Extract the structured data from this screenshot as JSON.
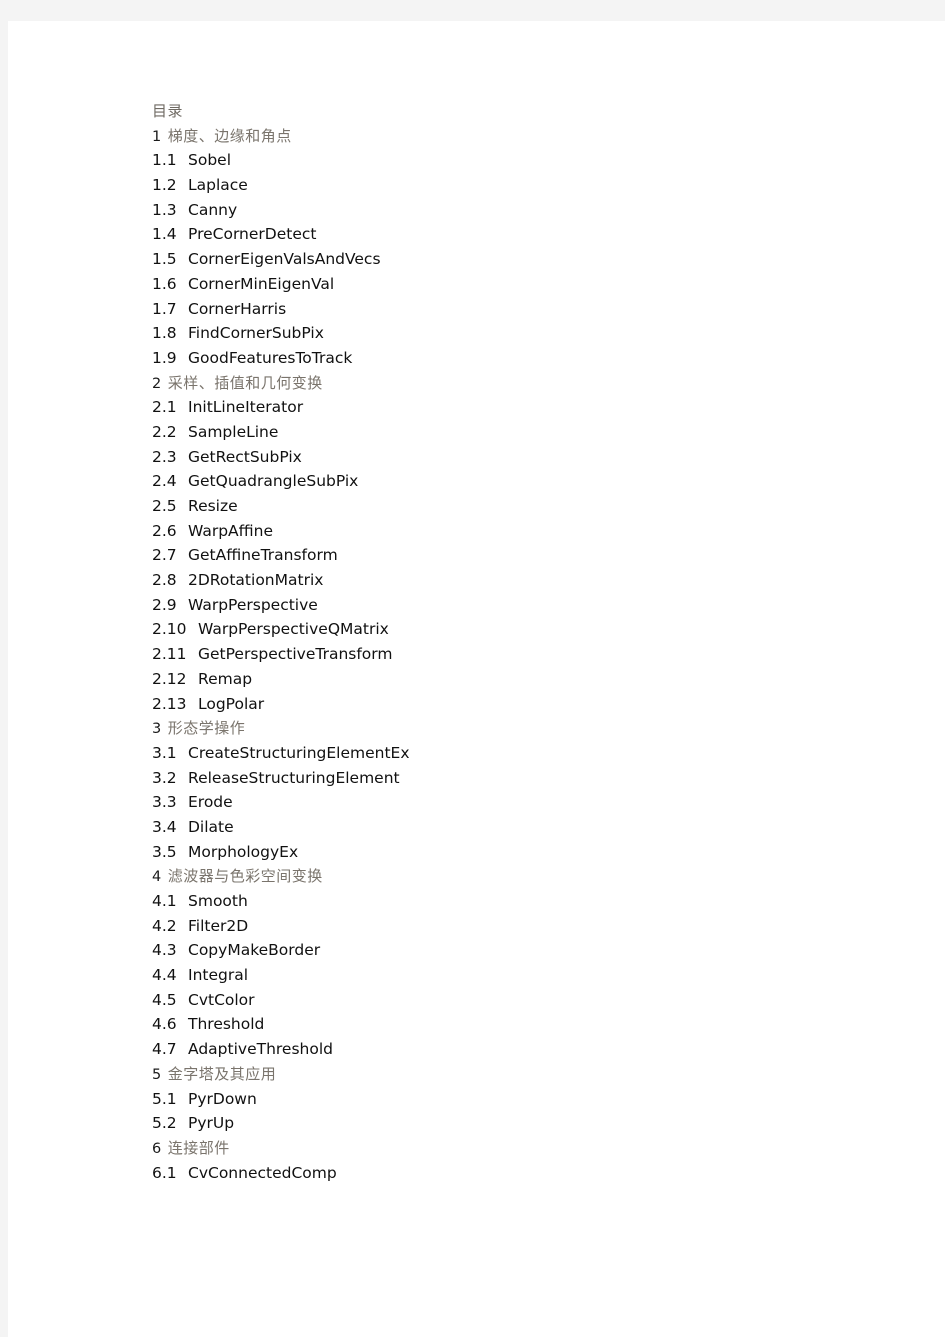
{
  "document": {
    "heading": "目录",
    "lines": [
      {
        "kind": "header",
        "text": "目录"
      },
      {
        "kind": "chapter",
        "num": "1",
        "title": "梯度、边缘和角点"
      },
      {
        "kind": "entry",
        "num": "1.1",
        "title": "Sobel"
      },
      {
        "kind": "entry",
        "num": "1.2",
        "title": "Laplace"
      },
      {
        "kind": "entry",
        "num": "1.3",
        "title": "Canny"
      },
      {
        "kind": "entry",
        "num": "1.4",
        "title": "PreCornerDetect"
      },
      {
        "kind": "entry",
        "num": "1.5",
        "title": "CornerEigenValsAndVecs"
      },
      {
        "kind": "entry",
        "num": "1.6",
        "title": "CornerMinEigenVal"
      },
      {
        "kind": "entry",
        "num": "1.7",
        "title": "CornerHarris"
      },
      {
        "kind": "entry",
        "num": "1.8",
        "title": "FindCornerSubPix"
      },
      {
        "kind": "entry",
        "num": "1.9",
        "title": "GoodFeaturesToTrack"
      },
      {
        "kind": "chapter",
        "num": "2",
        "title": "采样、插值和几何变换"
      },
      {
        "kind": "entry",
        "num": "2.1",
        "title": "InitLineIterator"
      },
      {
        "kind": "entry",
        "num": "2.2",
        "title": "SampleLine"
      },
      {
        "kind": "entry",
        "num": "2.3",
        "title": "GetRectSubPix"
      },
      {
        "kind": "entry",
        "num": "2.4",
        "title": "GetQuadrangleSubPix"
      },
      {
        "kind": "entry",
        "num": "2.5",
        "title": "Resize"
      },
      {
        "kind": "entry",
        "num": "2.6",
        "title": "WarpAffine"
      },
      {
        "kind": "entry",
        "num": "2.7",
        "title": "GetAffineTransform"
      },
      {
        "kind": "entry",
        "num": "2.8",
        "title": "2DRotationMatrix"
      },
      {
        "kind": "entry",
        "num": "2.9",
        "title": "WarpPerspective"
      },
      {
        "kind": "entry",
        "num": "2.10",
        "title": "WarpPerspectiveQMatrix",
        "wide": true
      },
      {
        "kind": "entry",
        "num": "2.11",
        "title": "GetPerspectiveTransform",
        "wide": true
      },
      {
        "kind": "entry",
        "num": "2.12",
        "title": "Remap",
        "wide": true
      },
      {
        "kind": "entry",
        "num": "2.13",
        "title": "LogPolar",
        "wide": true
      },
      {
        "kind": "chapter",
        "num": "3",
        "title": "形态学操作"
      },
      {
        "kind": "entry",
        "num": "3.1",
        "title": "CreateStructuringElementEx"
      },
      {
        "kind": "entry",
        "num": "3.2",
        "title": "ReleaseStructuringElement"
      },
      {
        "kind": "entry",
        "num": "3.3",
        "title": "Erode"
      },
      {
        "kind": "entry",
        "num": "3.4",
        "title": "Dilate"
      },
      {
        "kind": "entry",
        "num": "3.5",
        "title": "MorphologyEx"
      },
      {
        "kind": "chapter",
        "num": "4",
        "title": "滤波器与色彩空间变换"
      },
      {
        "kind": "entry",
        "num": "4.1",
        "title": "Smooth"
      },
      {
        "kind": "entry",
        "num": "4.2",
        "title": "Filter2D"
      },
      {
        "kind": "entry",
        "num": "4.3",
        "title": "CopyMakeBorder"
      },
      {
        "kind": "entry",
        "num": "4.4",
        "title": "Integral"
      },
      {
        "kind": "entry",
        "num": "4.5",
        "title": "CvtColor"
      },
      {
        "kind": "entry",
        "num": "4.6",
        "title": "Threshold"
      },
      {
        "kind": "entry",
        "num": "4.7",
        "title": "AdaptiveThreshold"
      },
      {
        "kind": "chapter",
        "num": "5",
        "title": "金字塔及其应用"
      },
      {
        "kind": "entry",
        "num": "5.1",
        "title": "PyrDown"
      },
      {
        "kind": "entry",
        "num": "5.2",
        "title": "PyrUp"
      },
      {
        "kind": "chapter",
        "num": "6",
        "title": "连接部件"
      },
      {
        "kind": "entry",
        "num": "6.1",
        "title": "CvConnectedComp"
      }
    ]
  },
  "colors": {
    "page_background": "#ffffff",
    "margin_background": "#f4f4f4",
    "entry_text": "#111111",
    "chapter_title_text": "#7a746c",
    "chapter_number_text": "#1a1a1a",
    "header_text": "#6f6a63"
  }
}
